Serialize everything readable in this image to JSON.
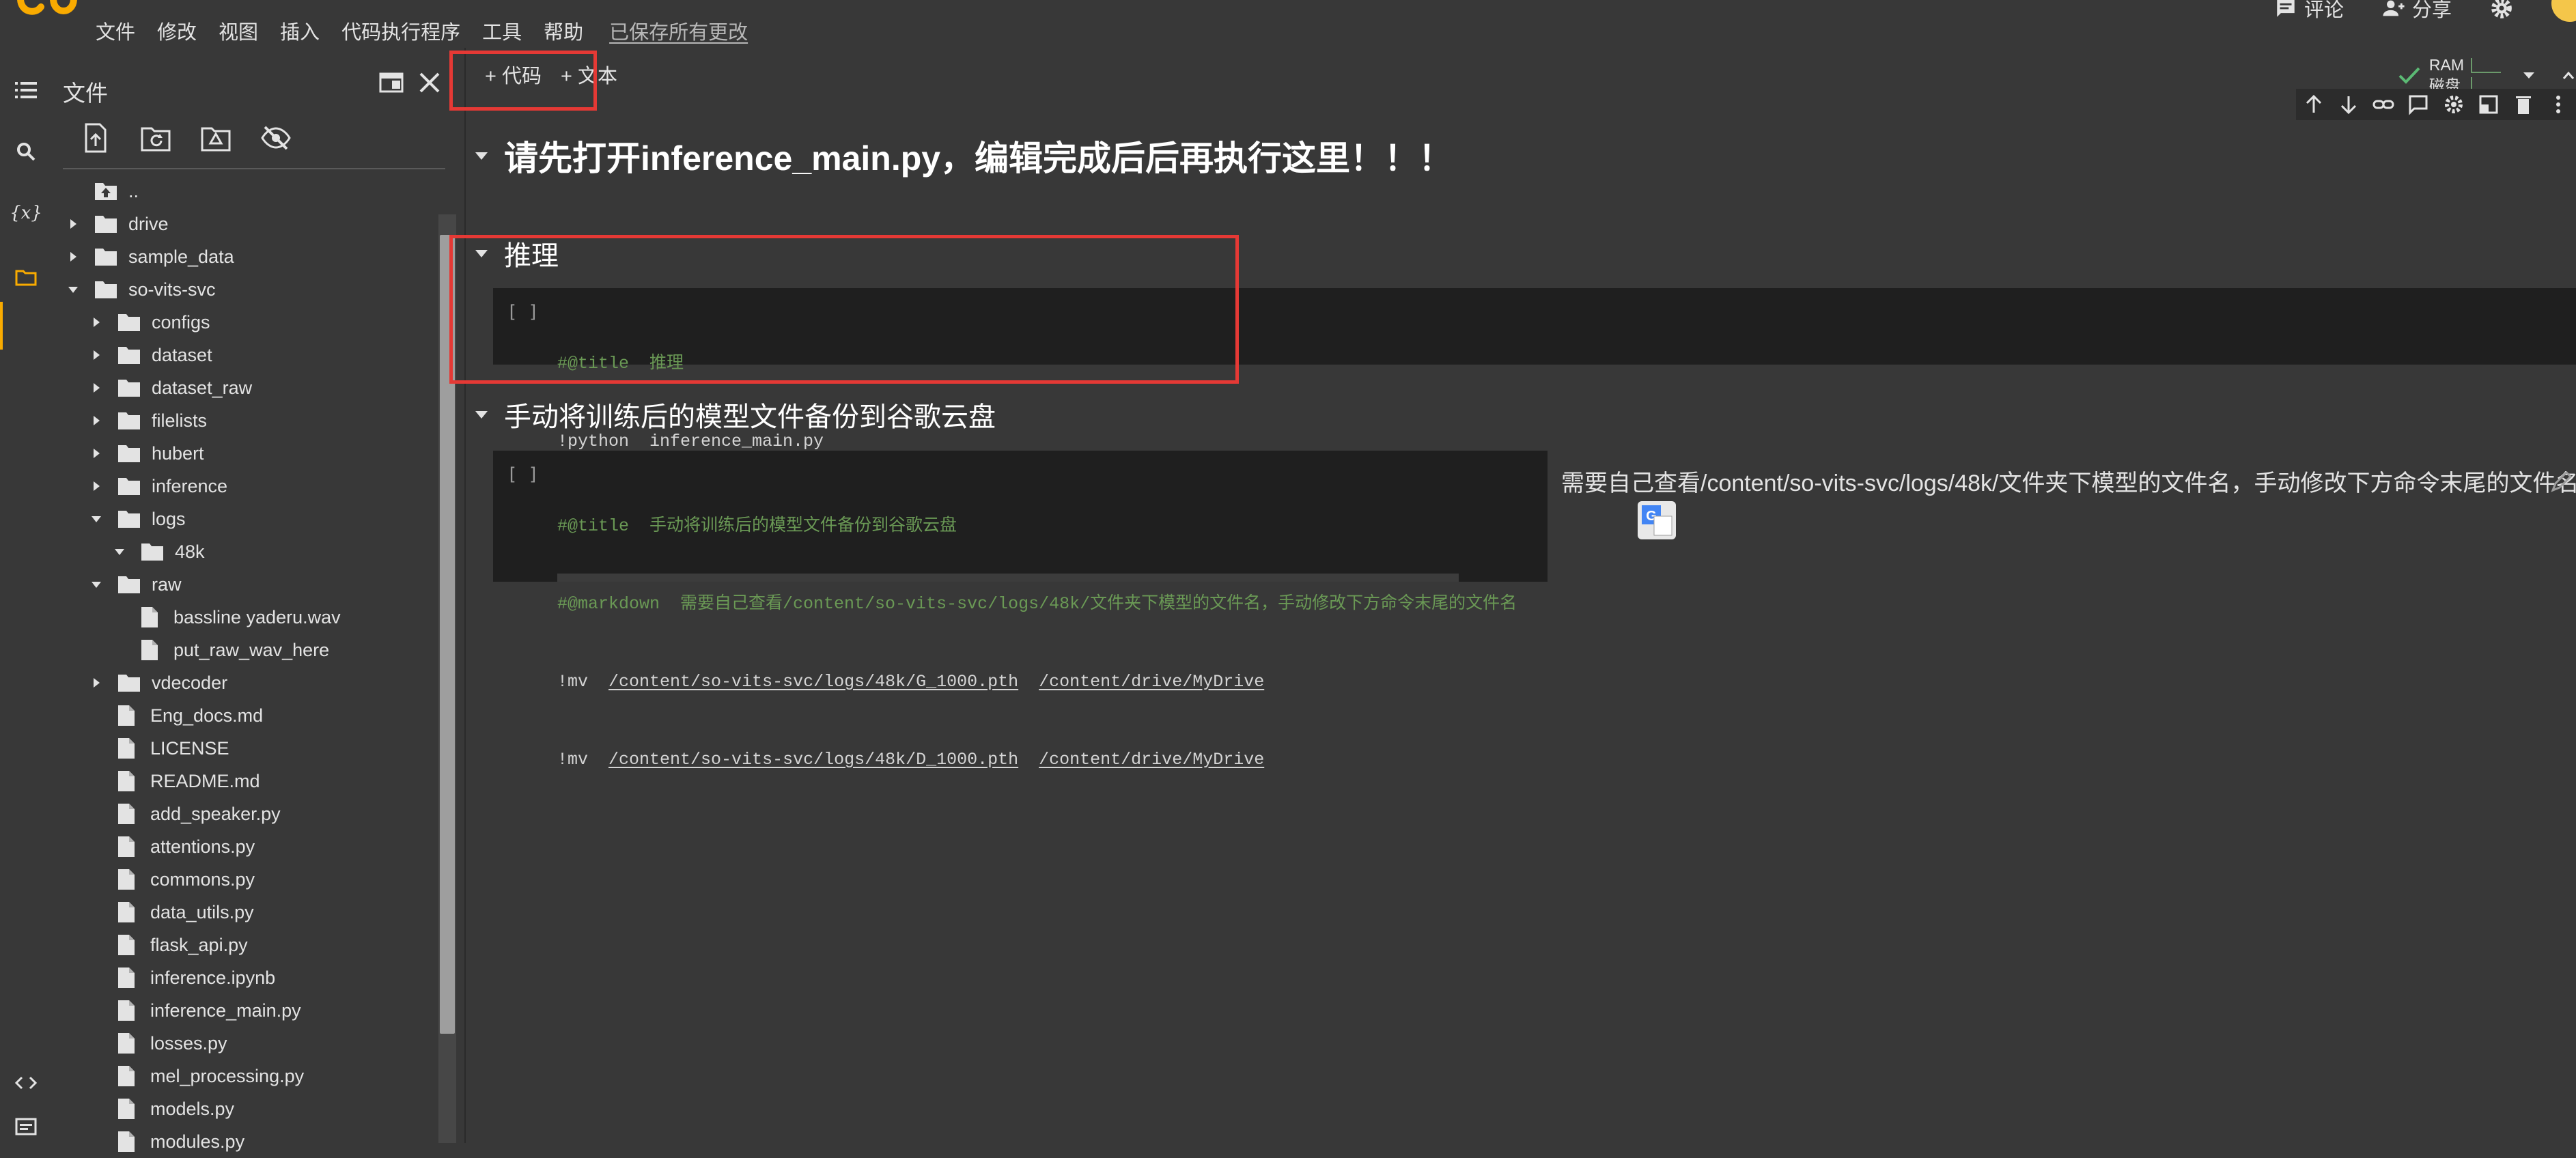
{
  "menu": {
    "items": [
      "文件",
      "修改",
      "视图",
      "插入",
      "代码执行程序",
      "工具",
      "帮助"
    ],
    "saved_status": "已保存所有更改"
  },
  "top_right": {
    "comment_label": "评论",
    "share_label": "分享"
  },
  "file_panel": {
    "title": "文件",
    "tree": [
      {
        "name": "..",
        "type": "up",
        "depth": 0,
        "caret": "none"
      },
      {
        "name": "drive",
        "type": "folder",
        "depth": 0,
        "caret": "right"
      },
      {
        "name": "sample_data",
        "type": "folder",
        "depth": 0,
        "caret": "right"
      },
      {
        "name": "so-vits-svc",
        "type": "folder",
        "depth": 0,
        "caret": "down"
      },
      {
        "name": "configs",
        "type": "folder",
        "depth": 1,
        "caret": "right"
      },
      {
        "name": "dataset",
        "type": "folder",
        "depth": 1,
        "caret": "right"
      },
      {
        "name": "dataset_raw",
        "type": "folder",
        "depth": 1,
        "caret": "right"
      },
      {
        "name": "filelists",
        "type": "folder",
        "depth": 1,
        "caret": "right"
      },
      {
        "name": "hubert",
        "type": "folder",
        "depth": 1,
        "caret": "right"
      },
      {
        "name": "inference",
        "type": "folder",
        "depth": 1,
        "caret": "right"
      },
      {
        "name": "logs",
        "type": "folder",
        "depth": 1,
        "caret": "down"
      },
      {
        "name": "48k",
        "type": "folder",
        "depth": 2,
        "caret": "down"
      },
      {
        "name": "raw",
        "type": "folder",
        "depth": 1,
        "caret": "down"
      },
      {
        "name": "bassline yaderu.wav",
        "type": "file",
        "depth": 2,
        "caret": "none"
      },
      {
        "name": "put_raw_wav_here",
        "type": "file",
        "depth": 2,
        "caret": "none"
      },
      {
        "name": "vdecoder",
        "type": "folder",
        "depth": 1,
        "caret": "right"
      },
      {
        "name": "Eng_docs.md",
        "type": "file",
        "depth": 1,
        "caret": "none"
      },
      {
        "name": "LICENSE",
        "type": "file",
        "depth": 1,
        "caret": "none"
      },
      {
        "name": "README.md",
        "type": "file",
        "depth": 1,
        "caret": "none"
      },
      {
        "name": "add_speaker.py",
        "type": "file",
        "depth": 1,
        "caret": "none"
      },
      {
        "name": "attentions.py",
        "type": "file",
        "depth": 1,
        "caret": "none"
      },
      {
        "name": "commons.py",
        "type": "file",
        "depth": 1,
        "caret": "none"
      },
      {
        "name": "data_utils.py",
        "type": "file",
        "depth": 1,
        "caret": "none"
      },
      {
        "name": "flask_api.py",
        "type": "file",
        "depth": 1,
        "caret": "none"
      },
      {
        "name": "inference.ipynb",
        "type": "file",
        "depth": 1,
        "caret": "none"
      },
      {
        "name": "inference_main.py",
        "type": "file",
        "depth": 1,
        "caret": "none"
      },
      {
        "name": "losses.py",
        "type": "file",
        "depth": 1,
        "caret": "none"
      },
      {
        "name": "mel_processing.py",
        "type": "file",
        "depth": 1,
        "caret": "none"
      },
      {
        "name": "models.py",
        "type": "file",
        "depth": 1,
        "caret": "none"
      },
      {
        "name": "modules.py",
        "type": "file",
        "depth": 1,
        "caret": "none"
      }
    ]
  },
  "notebook_toolbar": {
    "add_code": "+ 代码",
    "add_text": "+ 文本"
  },
  "resources": {
    "ram_label": "RAM",
    "disk_label": "磁盘"
  },
  "sections": {
    "heading1": "请先打开inference_main.py，编辑完成后后再执行这里！！！",
    "heading2": "推理",
    "heading3": "手动将训练后的模型文件备份到谷歌云盘"
  },
  "cells": {
    "run_bracket": "[ ]",
    "cell1": {
      "line1": "#@title  推理",
      "line2": "!python  inference_main.py"
    },
    "cell2": {
      "line1": "#@title  手动将训练后的模型文件备份到谷歌云盘",
      "line2": "#@markdown  需要自己查看/content/so-vits-svc/logs/48k/文件夹下模型的文件名，手动修改下方命令末尾的文件名",
      "cmd": "!mv",
      "src1": "/content/so-vits-svc/logs/48k/G_1000.pth",
      "dst1": "/content/drive/MyDrive",
      "src2": "/content/so-vits-svc/logs/48k/D_1000.pth",
      "dst2": "/content/drive/MyDrive"
    },
    "form_text": "需要自己查看/content/so-vits-svc/logs/48k/文件夹下模型的文件名，手动修改下方命令末尾的文件名"
  }
}
